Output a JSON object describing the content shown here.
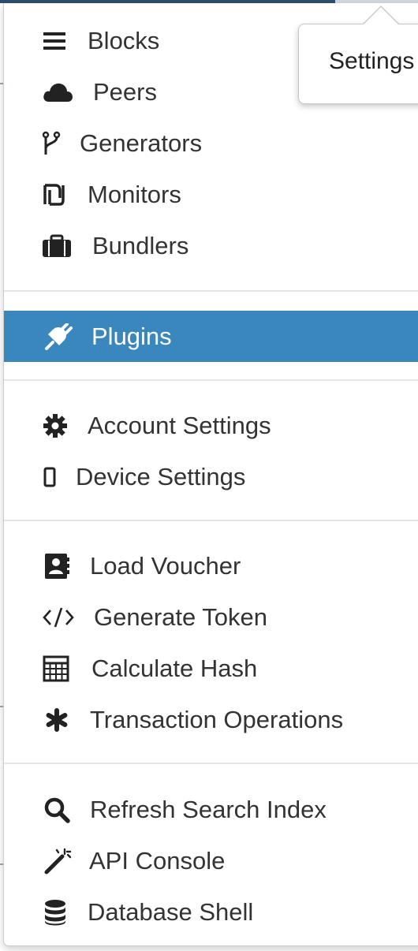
{
  "menu": {
    "groups": [
      {
        "items": [
          {
            "label": "Blocks",
            "icon": "bars-icon"
          },
          {
            "label": "Peers",
            "icon": "cloud-icon"
          },
          {
            "label": "Generators",
            "icon": "code-fork-icon"
          },
          {
            "label": "Monitors",
            "icon": "shekel-icon"
          },
          {
            "label": "Bundlers",
            "icon": "briefcase-icon"
          }
        ]
      },
      {
        "items": [
          {
            "label": "Plugins",
            "icon": "plug-icon",
            "active": true
          }
        ]
      },
      {
        "items": [
          {
            "label": "Account Settings",
            "icon": "gear-icon"
          },
          {
            "label": "Device Settings",
            "icon": "mobile-icon"
          }
        ]
      },
      {
        "items": [
          {
            "label": "Load Voucher",
            "icon": "address-book-icon"
          },
          {
            "label": "Generate Token",
            "icon": "code-icon"
          },
          {
            "label": "Calculate Hash",
            "icon": "calculator-icon"
          },
          {
            "label": "Transaction Operations",
            "icon": "asterisk-icon"
          }
        ]
      },
      {
        "items": [
          {
            "label": "Refresh Search Index",
            "icon": "search-icon"
          },
          {
            "label": "API Console",
            "icon": "magic-wand-icon"
          },
          {
            "label": "Database Shell",
            "icon": "database-icon"
          }
        ]
      }
    ]
  },
  "tooltip": {
    "text": "Settings"
  },
  "colors": {
    "accent": "#3a87be",
    "text": "#333333",
    "divider": "#e5e5e5"
  }
}
